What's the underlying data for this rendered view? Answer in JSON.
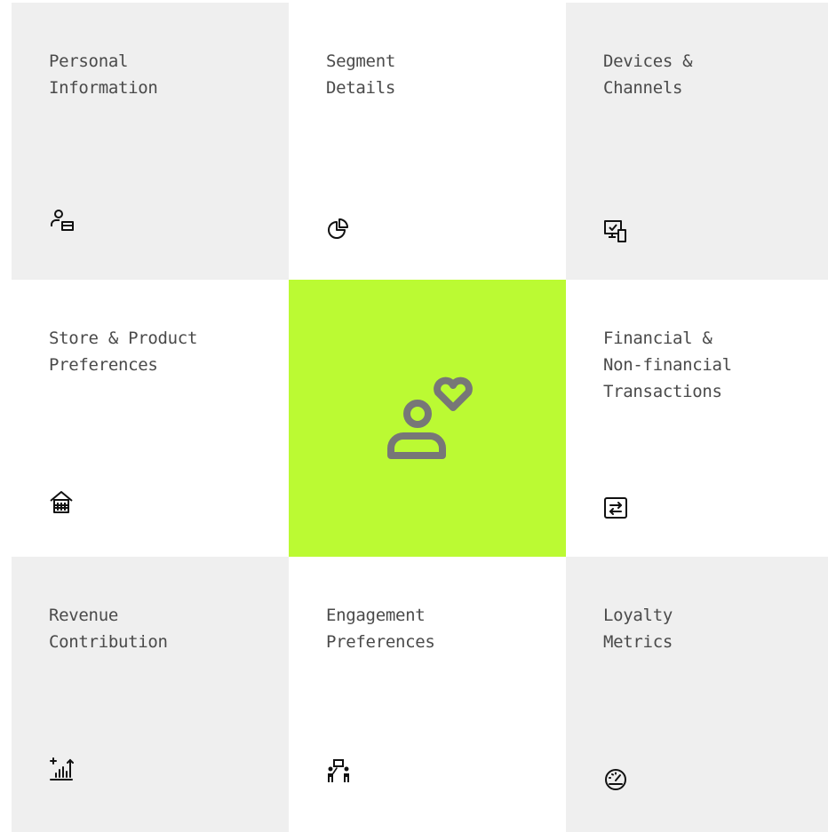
{
  "tiles": [
    {
      "title_line1": "Personal",
      "title_line2": "Information",
      "icon": "user-card-icon"
    },
    {
      "title_line1": "Segment",
      "title_line2": "Details",
      "icon": "pie-chart-icon"
    },
    {
      "title_line1": "Devices &",
      "title_line2": "Channels",
      "icon": "devices-icon"
    },
    {
      "title_line1": "Store & Product",
      "title_line2": "Preferences",
      "icon": "store-icon"
    },
    {
      "title_line1": "Financial &",
      "title_line2": "Non-financial",
      "title_line3": "Transactions",
      "icon": "transactions-icon"
    },
    {
      "title_line1": "Revenue",
      "title_line2": "Contribution",
      "icon": "revenue-chart-icon"
    },
    {
      "title_line1": "Engagement",
      "title_line2": "Preferences",
      "icon": "engagement-icon"
    },
    {
      "title_line1": "Loyalty",
      "title_line2": "Metrics",
      "icon": "gauge-icon"
    }
  ],
  "center": {
    "icon": "user-heart-icon"
  },
  "colors": {
    "tile_gray": "#efefef",
    "tile_white": "#ffffff",
    "accent": "#bbfa33",
    "text": "#4a4a4a",
    "icon": "#111111",
    "hero_icon": "#777777"
  }
}
